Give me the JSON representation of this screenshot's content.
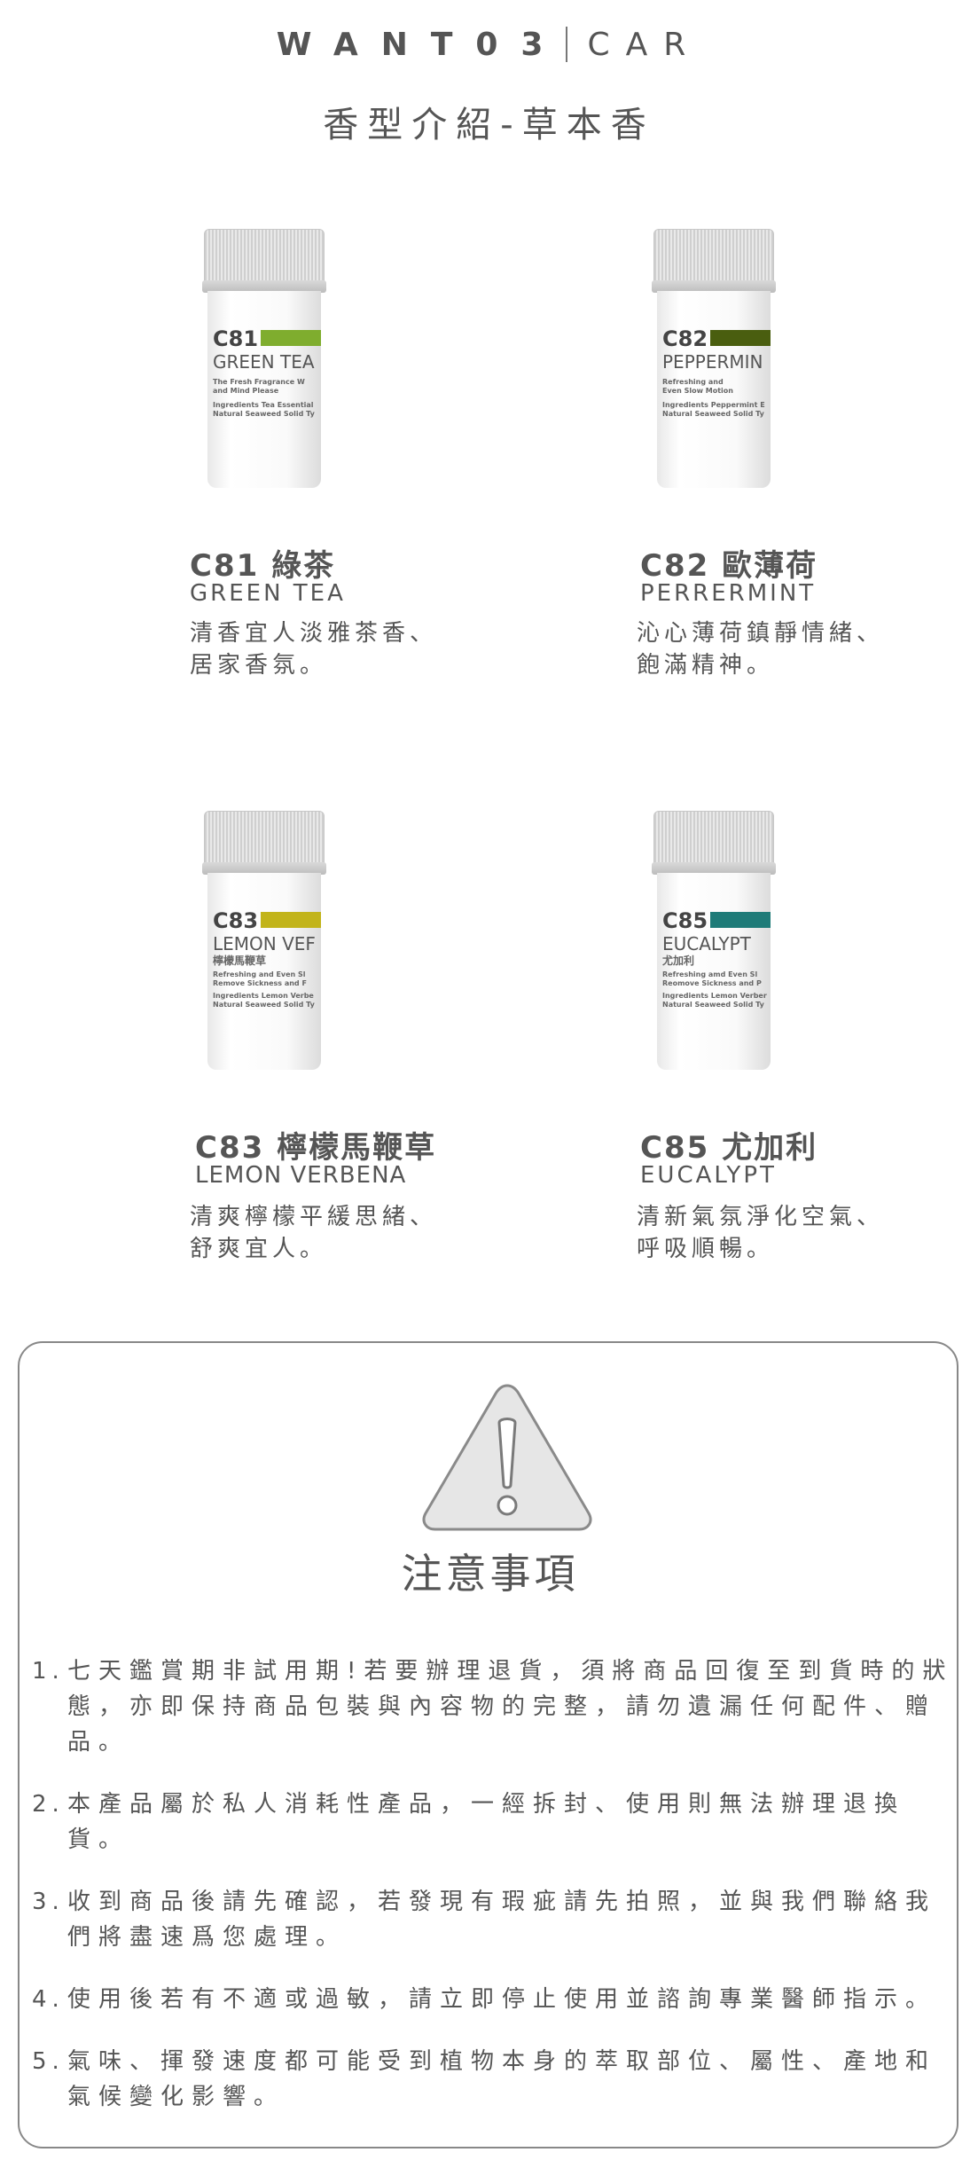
{
  "header": {
    "brand_left": "WANT03",
    "brand_right": "CAR",
    "subtitle": "香型介紹-草本香"
  },
  "products": [
    {
      "code": "C81",
      "title": "C81 綠茶",
      "english": "GREEN TEA",
      "desc_line1": "清香宜人淡雅茶香、",
      "desc_line2": "居家香氛。",
      "label_name": "GREEN TEA",
      "label_sub1": "The Fresh Fragrance W",
      "label_sub2": "and Mind Please",
      "label_ing1": "Ingredients Tea Essential",
      "label_ing2": "Natural Seaweed Solid Ty",
      "color": "#7fad2e"
    },
    {
      "code": "C82",
      "title": "C82 歐薄荷",
      "english": "PERRERMINT",
      "desc_line1": "沁心薄荷鎮靜情緒、",
      "desc_line2": "飽滿精神。",
      "label_name": "PEPPERMIN",
      "label_sub1": "Refreshing and",
      "label_sub2": "Even Slow Motion",
      "label_ing1": "Ingredients Peppermint E",
      "label_ing2": "Natural Seaweed Solid Ty",
      "color": "#4a5e0f"
    },
    {
      "code": "C83",
      "title": "C83 檸檬馬鞭草",
      "english": "LEMON VERBENA",
      "desc_line1": "清爽檸檬平緩思緒、",
      "desc_line2": "舒爽宜人。",
      "label_name": "LEMON VEF",
      "label_cn": "檸檬馬鞭草",
      "label_sub1": "Refreshing and Even Sl",
      "label_sub2": "Remove Sickness and F",
      "label_ing1": "Ingredients Lemon Verbe",
      "label_ing2": "Natural Seaweed Solid Ty",
      "color": "#c2b41a"
    },
    {
      "code": "C85",
      "title": "C85 尤加利",
      "english": "EUCALYPT",
      "desc_line1": "清新氣氛淨化空氣、",
      "desc_line2": "呼吸順暢。",
      "label_name": "EUCALYPT",
      "label_cn": "尤加利",
      "label_sub1": "Refreshing amd Even Sl",
      "label_sub2": "Reomove Sickness and P",
      "label_ing1": "Ingredients Lemon Verber",
      "label_ing2": "Natural Seaweed Solid Ty",
      "color": "#1e7b78"
    }
  ],
  "notice": {
    "icon": "warning-triangle-icon",
    "title": "注意事項",
    "items": [
      {
        "num": "1.",
        "text": "七天鑑賞期非試用期!若要辦理退貨，須將商品回復至到貨時的狀態，亦即保持商品包裝與內容物的完整，請勿遺漏任何配件、贈品。"
      },
      {
        "num": "2.",
        "text": "本產品屬於私人消耗性產品，一經拆封、使用則無法辦理退換貨。"
      },
      {
        "num": "3.",
        "text": "收到商品後請先確認，若發現有瑕疵請先拍照，並與我們聯絡我們將盡速爲您處理。"
      },
      {
        "num": "4.",
        "text": "使用後若有不適或過敏，請立即停止使用並諮詢專業醫師指示。"
      },
      {
        "num": "5.",
        "text": "氣味、揮發速度都可能受到植物本身的萃取部位、屬性、產地和氣候變化影響。"
      }
    ]
  }
}
